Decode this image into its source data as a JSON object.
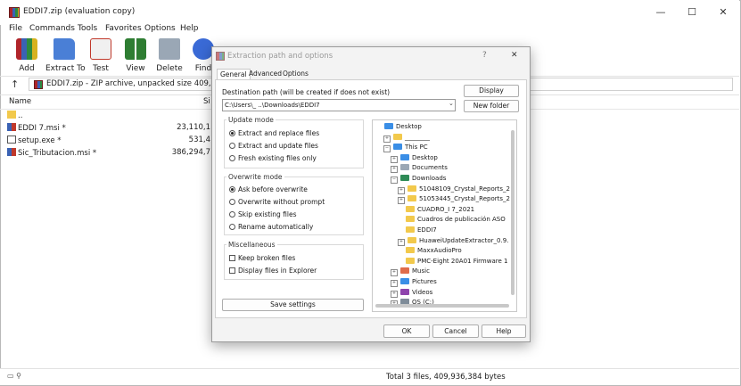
{
  "window": {
    "title": "EDDI7.zip (evaluation copy)",
    "controls": {
      "minimize": "—",
      "maximize": "☐",
      "close": "✕"
    }
  },
  "menu": [
    "File",
    "Commands",
    "Tools",
    "Favorites",
    "Options",
    "Help"
  ],
  "toolbar": [
    {
      "label": "Add",
      "icon": "add-archive-icon",
      "color": "#c0392b"
    },
    {
      "label": "Extract To",
      "icon": "extract-folder-icon",
      "color": "#4a7fd6"
    },
    {
      "label": "Test",
      "icon": "test-icon",
      "color": "#d64a3a"
    },
    {
      "label": "View",
      "icon": "view-book-icon",
      "color": "#2e7d32"
    },
    {
      "label": "Delete",
      "icon": "trash-icon",
      "color": "#7f8c99"
    },
    {
      "label": "Find",
      "icon": "find-magnifier-icon",
      "color": "#3a6ad6"
    }
  ],
  "address": {
    "text": "EDDI7.zip - ZIP archive, unpacked size 409,936,3"
  },
  "columns": {
    "name": "Name",
    "size": "Si"
  },
  "files": [
    {
      "name": "..",
      "size": "",
      "icon": "folder-icon"
    },
    {
      "name": "EDDI 7.msi *",
      "size": "23,110,1",
      "icon": "msi-icon"
    },
    {
      "name": "setup.exe *",
      "size": "531,4",
      "icon": "exe-icon"
    },
    {
      "name": "Sic_Tributacion.msi *",
      "size": "386,294,7",
      "icon": "msi-icon"
    }
  ],
  "status": {
    "right": "Total 3 files, 409,936,384 bytes"
  },
  "dialog": {
    "title": "Extraction path and options",
    "help_btn": "?",
    "close_btn": "✕",
    "tabs": [
      "General",
      "Advanced",
      "Options"
    ],
    "dest_label": "Destination path (will be created if does not exist)",
    "dest_value": "C:\\Users\\_    ..\\Downloads\\EDDI7",
    "display_btn": "Display",
    "newfolder_btn": "New folder",
    "update_mode": {
      "title": "Update mode",
      "options": [
        "Extract and replace files",
        "Extract and update files",
        "Fresh existing files only"
      ],
      "selected": 0
    },
    "overwrite_mode": {
      "title": "Overwrite mode",
      "options": [
        "Ask before overwrite",
        "Overwrite without prompt",
        "Skip existing files",
        "Rename automatically"
      ],
      "selected": 0
    },
    "misc": {
      "title": "Miscellaneous",
      "options": [
        "Keep broken files",
        "Display files in Explorer"
      ]
    },
    "save_btn": "Save settings",
    "tree": [
      {
        "label": "Desktop",
        "indent": 0,
        "exp": "",
        "color": "#3a8ee6"
      },
      {
        "label": "________",
        "indent": 1,
        "exp": "+",
        "color": "#f2c94c"
      },
      {
        "label": "This PC",
        "indent": 1,
        "exp": "−",
        "color": "#3a8ee6"
      },
      {
        "label": "Desktop",
        "indent": 2,
        "exp": "+",
        "color": "#3a8ee6"
      },
      {
        "label": "Documents",
        "indent": 2,
        "exp": "+",
        "color": "#9aa7b5"
      },
      {
        "label": "Downloads",
        "indent": 2,
        "exp": "−",
        "color": "#2e8b57"
      },
      {
        "label": "51048109_Crystal_Reports_2",
        "indent": 3,
        "exp": "+",
        "color": "#f2c94c"
      },
      {
        "label": "51053445_Crystal_Reports_2",
        "indent": 3,
        "exp": "+",
        "color": "#f2c94c"
      },
      {
        "label": "CUADRO_I 7_2021",
        "indent": 3,
        "exp": "",
        "color": "#f2c94c"
      },
      {
        "label": "Cuadros de publicación ASO",
        "indent": 3,
        "exp": "",
        "color": "#f2c94c"
      },
      {
        "label": "EDDI7",
        "indent": 3,
        "exp": "",
        "color": "#f2c94c"
      },
      {
        "label": "HuaweiUpdateExtractor_0.9.",
        "indent": 3,
        "exp": "+",
        "color": "#f2c94c"
      },
      {
        "label": "MaxxAudioPro",
        "indent": 3,
        "exp": "",
        "color": "#f2c94c"
      },
      {
        "label": "PMC-Eight 20A01 Firmware 1",
        "indent": 3,
        "exp": "",
        "color": "#f2c94c"
      },
      {
        "label": "Music",
        "indent": 2,
        "exp": "+",
        "color": "#e06c4a"
      },
      {
        "label": "Pictures",
        "indent": 2,
        "exp": "+",
        "color": "#3a8ee6"
      },
      {
        "label": "Videos",
        "indent": 2,
        "exp": "+",
        "color": "#8e44ad"
      },
      {
        "label": "OS (C:)",
        "indent": 2,
        "exp": "+",
        "color": "#7f8c99"
      }
    ],
    "ok_btn": "OK",
    "cancel_btn": "Cancel",
    "help_btn_bottom": "Help"
  }
}
